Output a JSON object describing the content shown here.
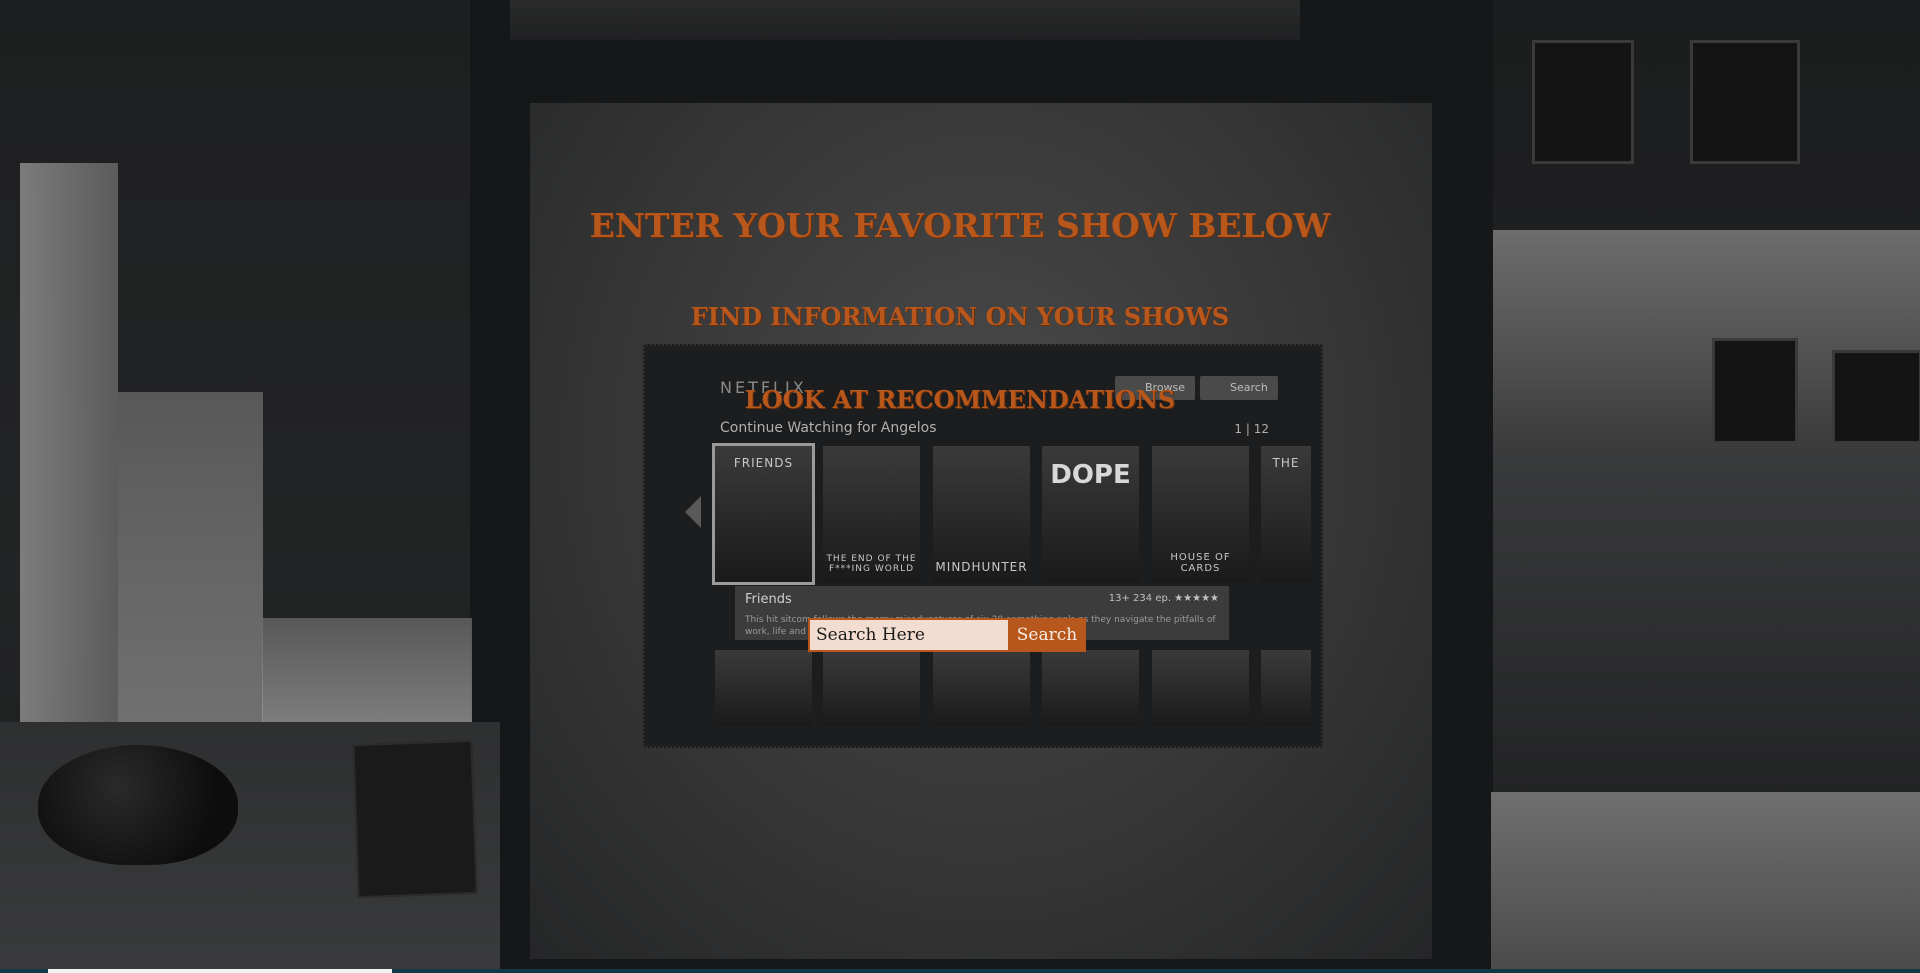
{
  "headings": {
    "main": "ENTER YOUR FAVORITE SHOW BELOW",
    "sub1": "FIND INFORMATION ON YOUR SHOWS",
    "sub2": "LOOK AT RECOMMENDATIONS"
  },
  "search": {
    "placeholder": "Search Here",
    "button_label": "Search"
  },
  "background_tv": {
    "logo": "NETFLIX",
    "browse_label": "Browse",
    "search_label": "Search",
    "row_title": "Continue Watching for Angelos",
    "pager": "1 | 12",
    "posters": [
      "FRIENDS",
      "THE END OF THE F***ING WORLD",
      "MINDHUNTER",
      "DOPE",
      "HOUSE OF CARDS",
      "THE"
    ],
    "info_title": "Friends",
    "info_meta": "13+   234 ep.  ★★★★★",
    "info_desc": "This hit sitcom follows the merry misadventures of six 20-something pals as they navigate the pitfalls of work, life and love."
  },
  "colors": {
    "accent": "#b8571c",
    "input_bg": "#f2ddd0"
  }
}
